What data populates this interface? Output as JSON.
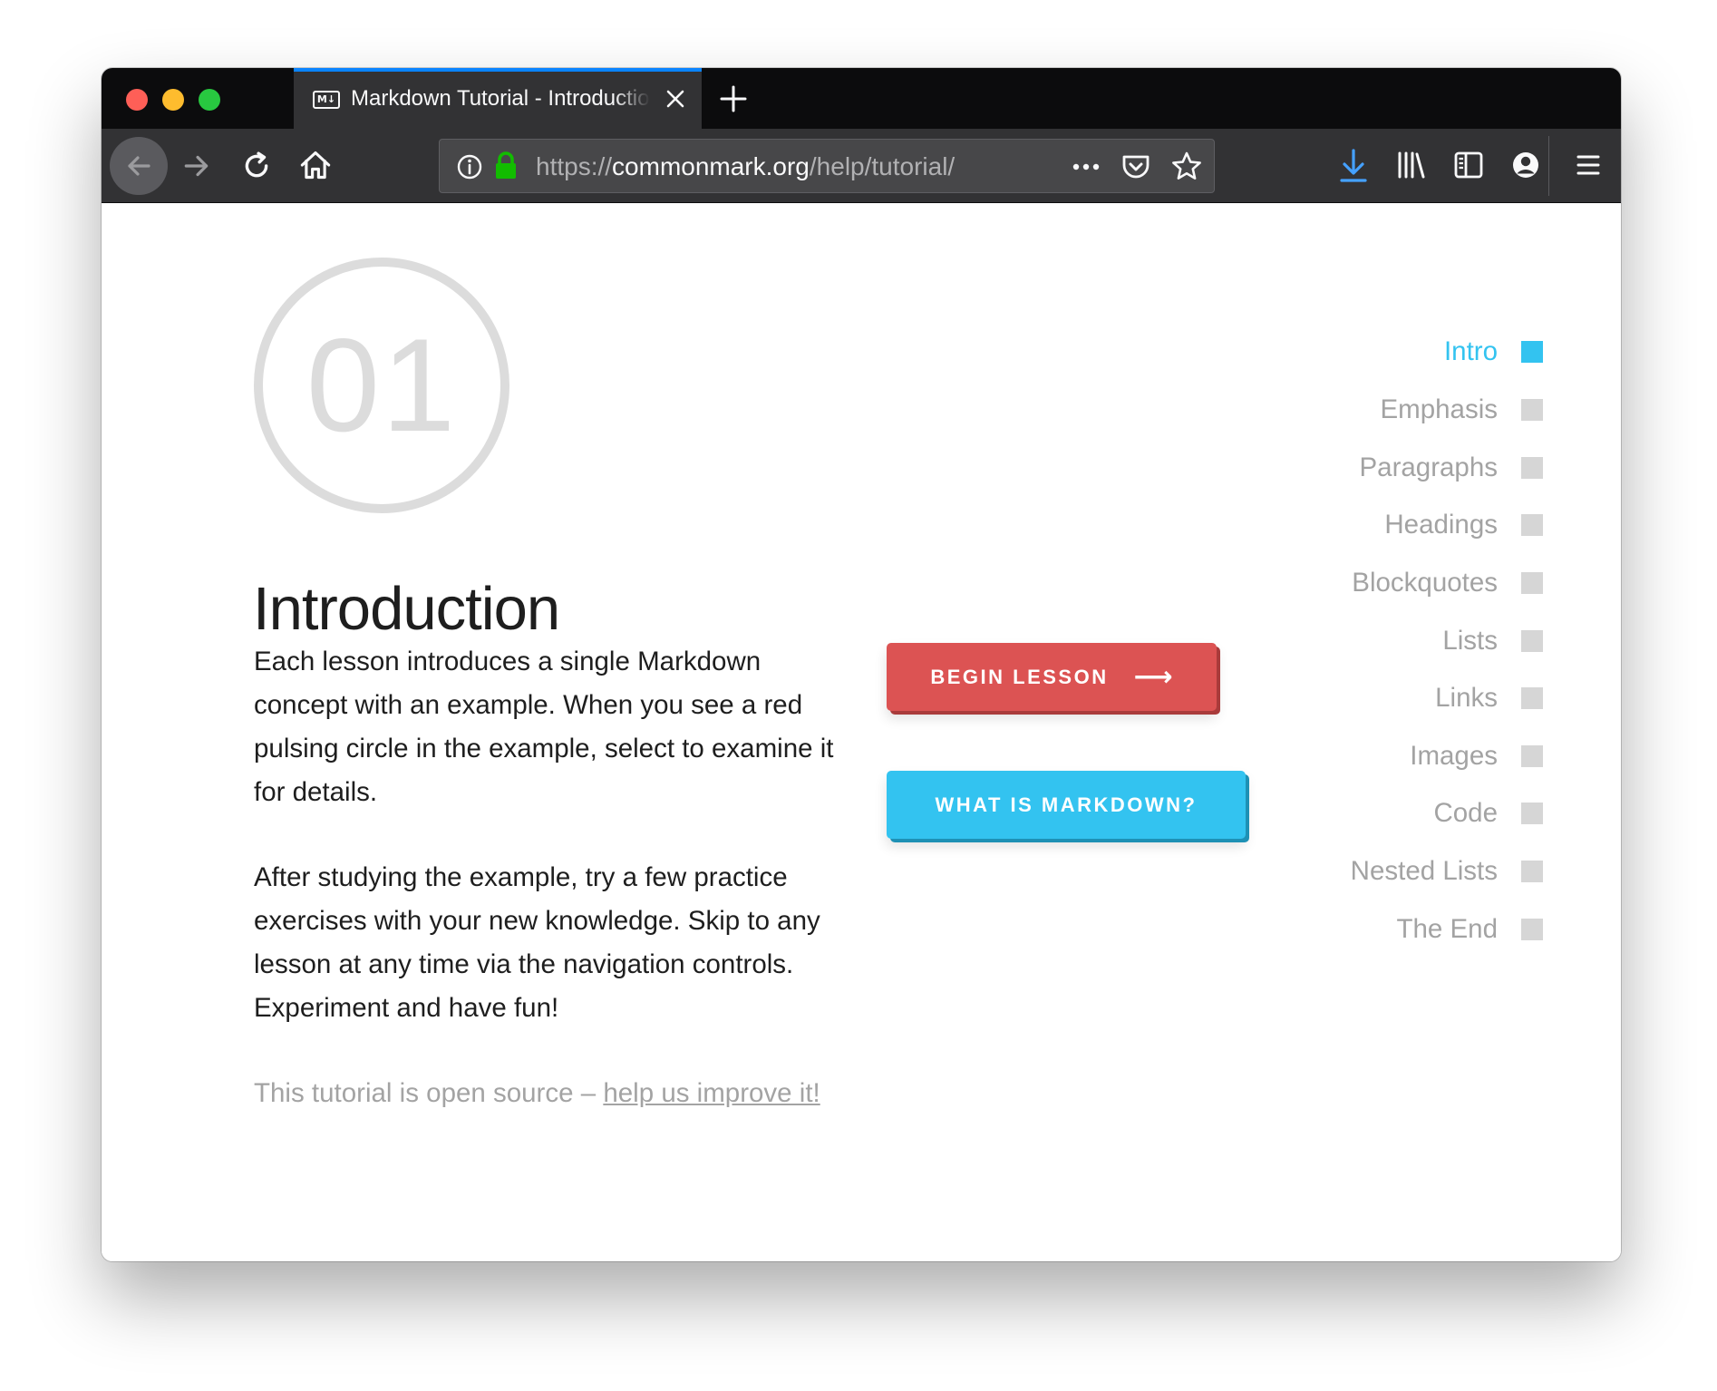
{
  "browser": {
    "tab": {
      "favicon_text": "M↓",
      "title": "Markdown Tutorial - Introduction"
    },
    "url": {
      "scheme": "https://",
      "host": "commonmark.org",
      "path": "/help/tutorial/"
    },
    "icons": [
      "close-icon",
      "new-tab-icon",
      "back-icon",
      "forward-icon",
      "reload-icon",
      "home-icon",
      "info-icon",
      "lock-icon",
      "more-icon",
      "pocket-icon",
      "bookmark-star-icon",
      "download-icon",
      "library-icon",
      "sidebar-icon",
      "account-icon",
      "menu-icon"
    ],
    "accent_color": "#0a84ff",
    "secure_color": "#12bc00"
  },
  "lesson": {
    "number": "01",
    "title": "Introduction",
    "paragraphs": [
      "Each lesson introduces a single Markdown concept with an example. When you see a red pulsing circle in the example, select to examine it for details.",
      "After studying the example, try a few practice exercises with your new knowledge. Skip to any lesson at any time via the navigation controls. Experiment and have fun!"
    ],
    "footer_text": "This tutorial is open source – ",
    "footer_link": "help us improve it!"
  },
  "buttons": {
    "begin_label": "BEGIN LESSON",
    "begin_arrow": "⟶",
    "begin_color": "#dc5353",
    "what_label": "WHAT IS MARKDOWN?",
    "what_color": "#33c3f0"
  },
  "nav": {
    "active_color": "#33c3f0",
    "items": [
      {
        "label": "Intro",
        "active": true
      },
      {
        "label": "Emphasis",
        "active": false
      },
      {
        "label": "Paragraphs",
        "active": false
      },
      {
        "label": "Headings",
        "active": false
      },
      {
        "label": "Blockquotes",
        "active": false
      },
      {
        "label": "Lists",
        "active": false
      },
      {
        "label": "Links",
        "active": false
      },
      {
        "label": "Images",
        "active": false
      },
      {
        "label": "Code",
        "active": false
      },
      {
        "label": "Nested Lists",
        "active": false
      },
      {
        "label": "The End",
        "active": false
      }
    ]
  }
}
